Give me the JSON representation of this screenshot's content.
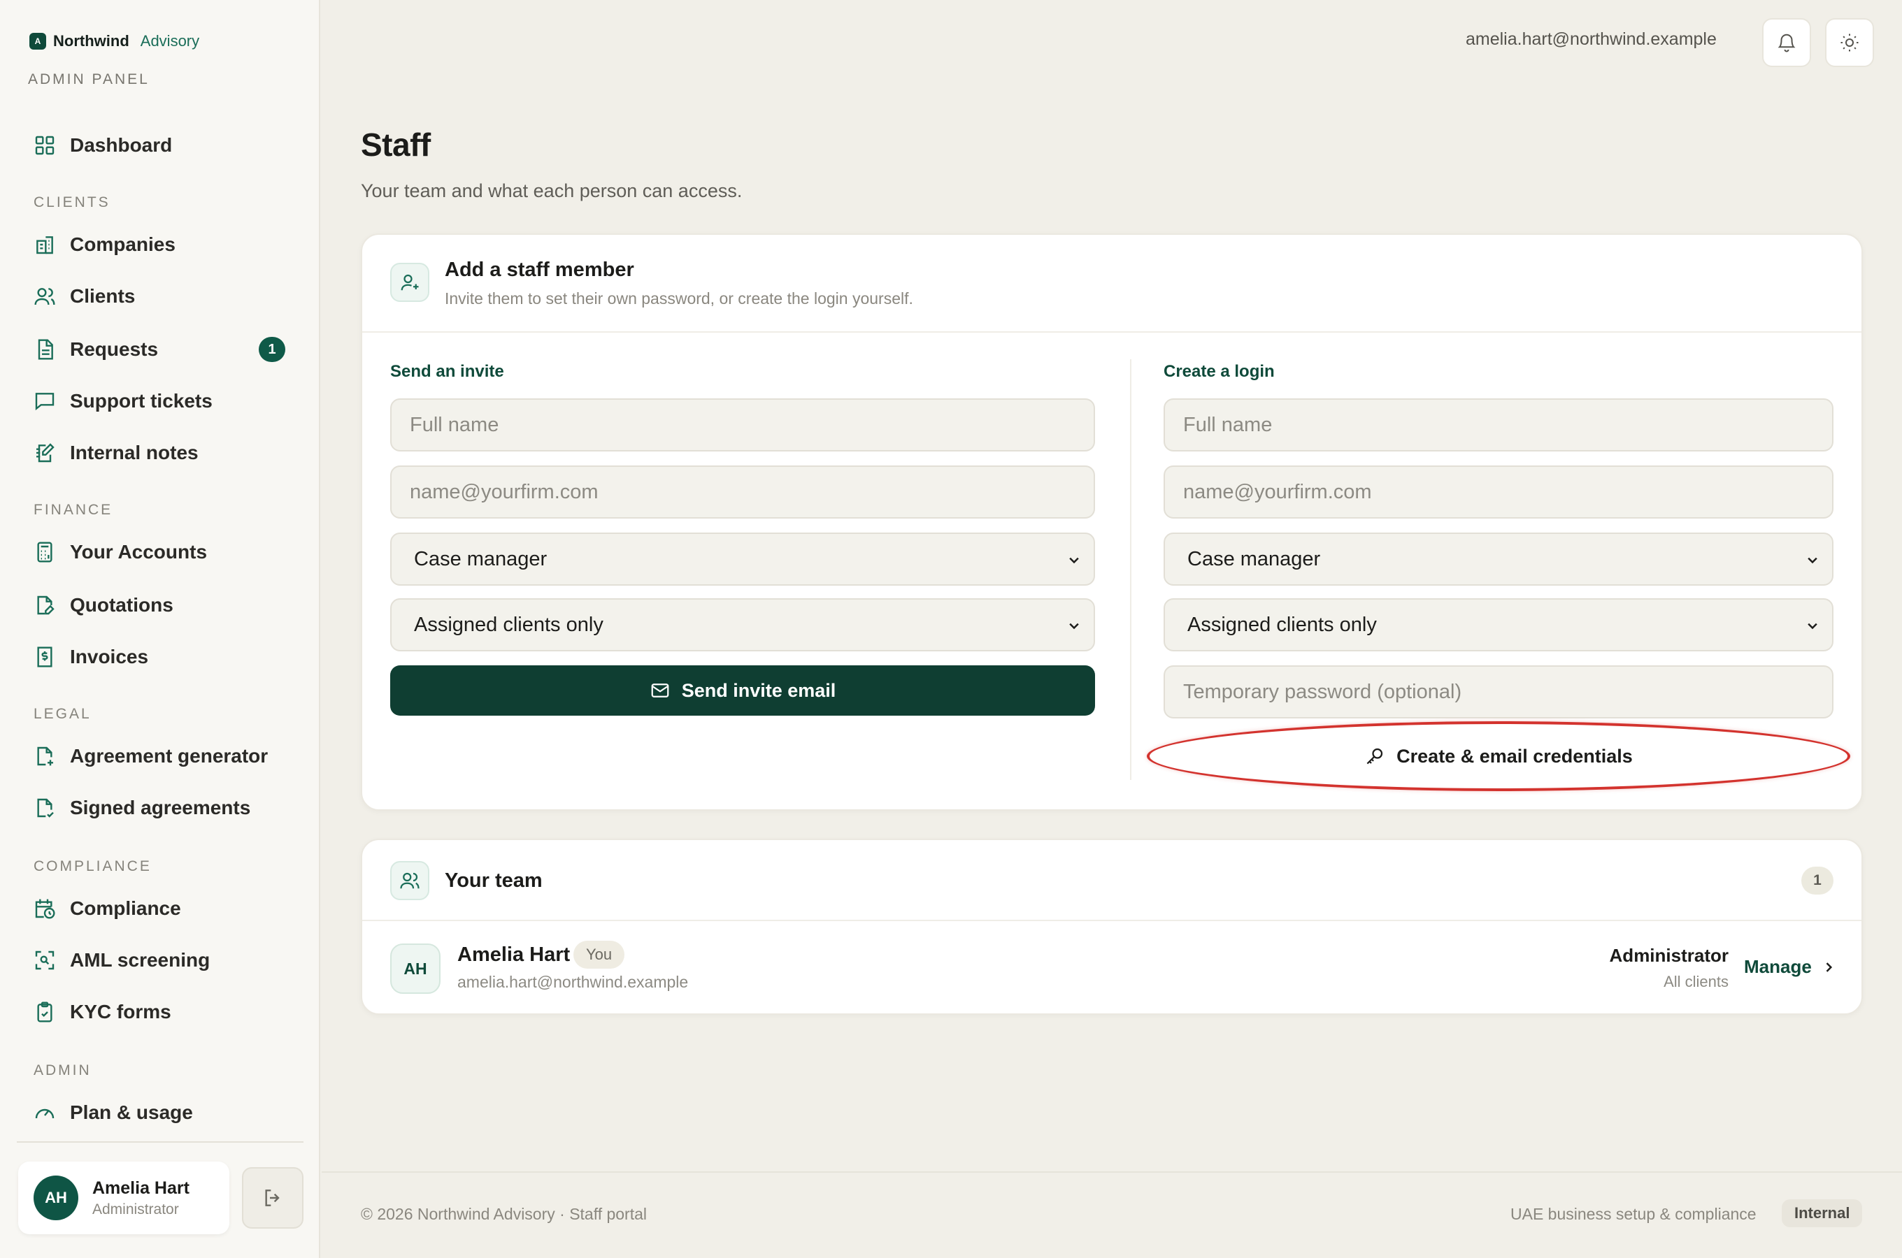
{
  "brand": {
    "name": "Northwind",
    "sub": "Advisory",
    "mark": "A",
    "panel_label": "ADMIN PANEL"
  },
  "sidebar": {
    "dashboard": "Dashboard",
    "sections": {
      "clients": "CLIENTS",
      "finance": "FINANCE",
      "legal": "LEGAL",
      "compliance": "COMPLIANCE",
      "admin": "ADMIN"
    },
    "items": {
      "companies": "Companies",
      "clients": "Clients",
      "requests": "Requests",
      "requests_badge": "1",
      "support": "Support tickets",
      "notes": "Internal notes",
      "accounts": "Your Accounts",
      "quotations": "Quotations",
      "invoices": "Invoices",
      "agreement": "Agreement generator",
      "signed": "Signed agreements",
      "compliance": "Compliance",
      "aml": "AML screening",
      "kyc": "KYC forms",
      "plan": "Plan & usage"
    },
    "user": {
      "initials": "AH",
      "name": "Amelia Hart",
      "role": "Administrator"
    }
  },
  "topbar": {
    "email": "amelia.hart@northwind.example"
  },
  "page": {
    "title": "Staff",
    "subtitle": "Your team and what each person can access."
  },
  "add_staff": {
    "title": "Add a staff member",
    "subtitle": "Invite them to set their own password, or create the login yourself.",
    "invite": {
      "label": "Send an invite",
      "name_placeholder": "Full name",
      "email_placeholder": "name@yourfirm.com",
      "role": "Case manager",
      "access": "Assigned clients only",
      "button": "Send invite email"
    },
    "login": {
      "label": "Create a login",
      "name_placeholder": "Full name",
      "email_placeholder": "name@yourfirm.com",
      "role": "Case manager",
      "access": "Assigned clients only",
      "password_placeholder": "Temporary password (optional)",
      "button": "Create & email credentials"
    }
  },
  "team": {
    "title": "Your team",
    "count": "1",
    "members": [
      {
        "initials": "AH",
        "name": "Amelia Hart",
        "tag": "You",
        "email": "amelia.hart@northwind.example",
        "role": "Administrator",
        "access": "All clients",
        "action": "Manage"
      }
    ]
  },
  "footer": {
    "left": "© 2026 Northwind Advisory · Staff portal",
    "right": "UAE business setup & compliance",
    "pill": "Internal"
  },
  "colors": {
    "accent": "#0f3e32",
    "highlight": "#d3332e",
    "badge": "#0f5a48"
  }
}
